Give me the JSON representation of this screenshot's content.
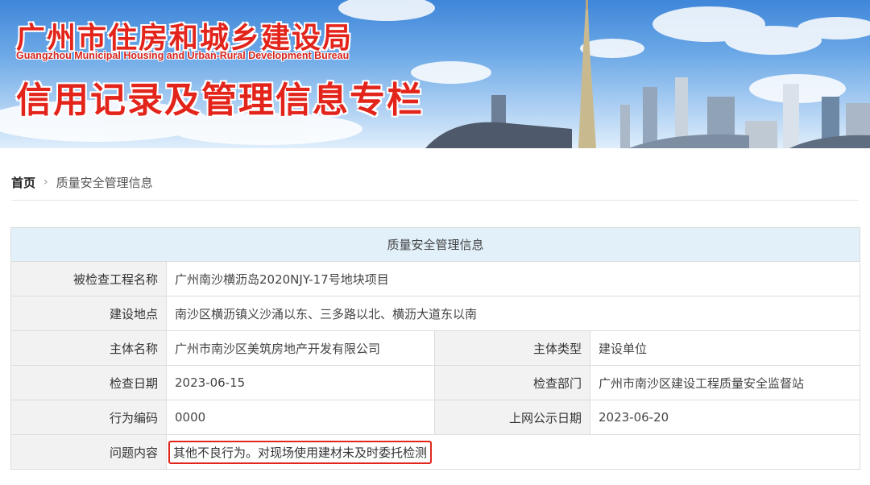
{
  "banner": {
    "title_cn": "广州市住房和城乡建设局",
    "title_en": "Guangzhou Municipal Housing and Urban-Rural Development Bureau",
    "subtitle": "信用记录及管理信息专栏"
  },
  "breadcrumb": {
    "home": "首页",
    "separator": "›",
    "current": "质量安全管理信息"
  },
  "table": {
    "heading": "质量安全管理信息",
    "project_label": "被检查工程名称",
    "project_value": "广州南沙横沥岛2020NJY-17号地块项目",
    "location_label": "建设地点",
    "location_value": "南沙区横沥镇义沙涌以东、三多路以北、横沥大道东以南",
    "subject_label": "主体名称",
    "subject_value": "广州市南沙区美筑房地产开发有限公司",
    "subject_type_label": "主体类型",
    "subject_type_value": "建设单位",
    "check_date_label": "检查日期",
    "check_date_value": "2023-06-15",
    "dept_label": "检查部门",
    "dept_value": "广州市南沙区建设工程质量安全监督站",
    "code_label": "行为编码",
    "code_value": "0000",
    "publish_label": "上网公示日期",
    "publish_value": "2023-06-20",
    "issue_label": "问题内容",
    "issue_value": "其他不良行为。对现场使用建材未及时委托检测"
  },
  "colors": {
    "brand_red": "#e3241b",
    "table_head_bg": "#e2f0fa",
    "label_bg": "#f2f2f2",
    "highlight_border": "#e1271c"
  }
}
